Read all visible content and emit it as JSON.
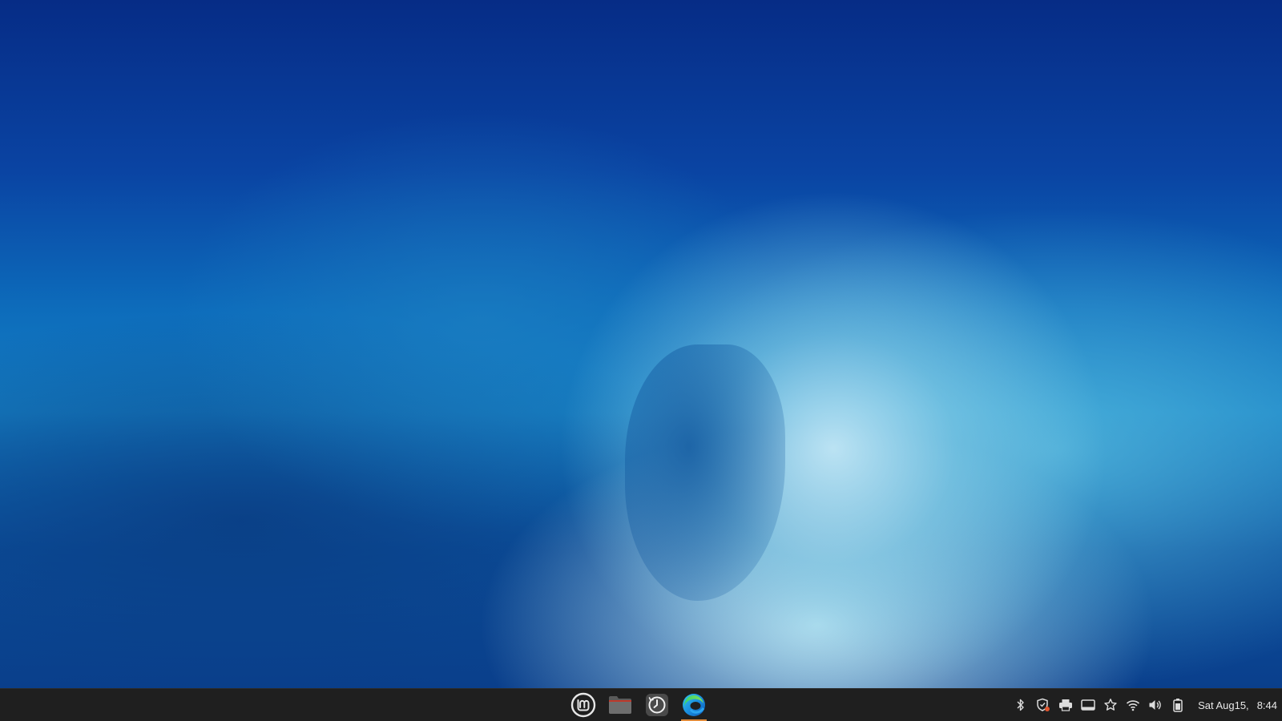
{
  "desktop": {
    "wallpaper": "ocean-wave",
    "colors": {
      "deep": "#062c86",
      "mid": "#1580c4",
      "foam": "#d2f0fa"
    }
  },
  "taskbar": {
    "background": "#1f1f1f",
    "launchers": [
      {
        "name": "mint-menu",
        "icon": "linux-mint-logo-icon"
      },
      {
        "name": "files",
        "icon": "folder-icon"
      },
      {
        "name": "timeshift",
        "icon": "timeshift-clock-icon"
      },
      {
        "name": "microsoft-edge",
        "icon": "edge-browser-icon",
        "active": true
      }
    ],
    "tray": {
      "icons": [
        "bluetooth-icon",
        "update-shield-icon",
        "printer-icon",
        "display-icon",
        "favorites-star-icon",
        "wifi-icon",
        "volume-icon",
        "battery-icon"
      ],
      "date": "Sat Aug15,",
      "time": "8:44"
    },
    "active_indicator_color": "#e08a3a"
  }
}
